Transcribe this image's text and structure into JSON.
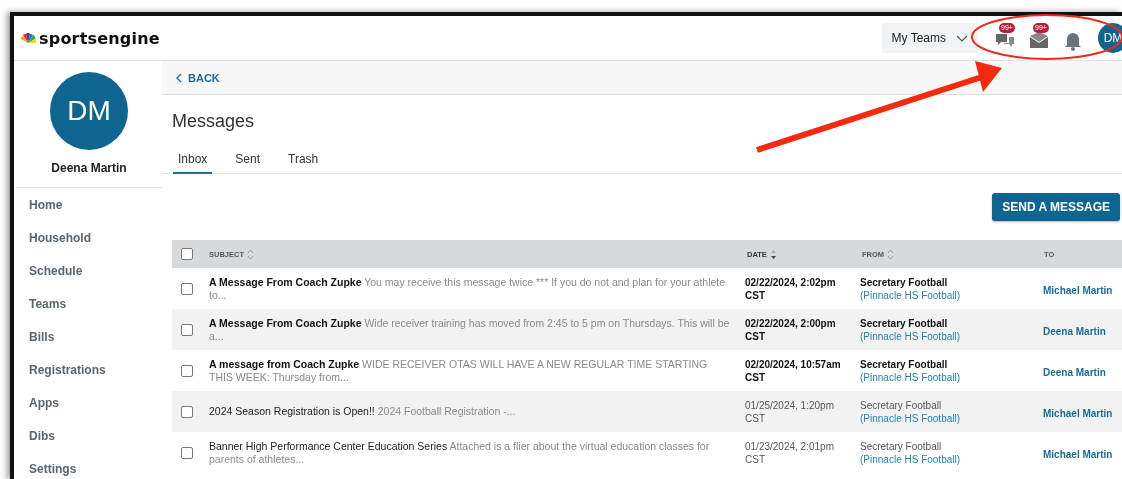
{
  "header": {
    "logo": "sportsengine",
    "team_menu": "My Teams",
    "icons": [
      {
        "kind": "chat",
        "badge": "99+"
      },
      {
        "kind": "mail",
        "badge": "99+"
      },
      {
        "kind": "bell"
      }
    ],
    "avatar": "DM"
  },
  "profile": {
    "initials": "DM",
    "name": "Deena Martin"
  },
  "nav": [
    {
      "label": "Home"
    },
    {
      "label": "Household"
    },
    {
      "label": "Schedule"
    },
    {
      "label": "Teams"
    },
    {
      "label": "Bills"
    },
    {
      "label": "Registrations"
    },
    {
      "label": "Apps"
    },
    {
      "label": "Dibs"
    },
    {
      "label": "Settings"
    }
  ],
  "back": "BACK",
  "title": "Messages",
  "tabs": [
    {
      "label": "Inbox",
      "selected": true
    },
    {
      "label": "Sent",
      "selected": false
    },
    {
      "label": "Trash",
      "selected": false
    }
  ],
  "send_button": "SEND A MESSAGE",
  "table": {
    "select_all": {
      "checked": false
    },
    "columns": [
      {
        "label": "SUBJECT",
        "sortable": true,
        "sorted": false
      },
      {
        "label": "DATE",
        "sortable": true,
        "sorted": true
      },
      {
        "label": "FROM",
        "sortable": true,
        "sorted": false
      },
      {
        "label": "TO",
        "sortable": false,
        "sorted": false
      }
    ],
    "rows": [
      {
        "checked": false,
        "unread": true,
        "subject": "A Message From Coach Zupke",
        "preview": "You may receive this message twice *** If you do not and plan for your athlete to...",
        "date": "02/22/2024, 2:02pm",
        "timezone": "CST",
        "sender": "Secretary Football",
        "team": "(Pinnacle HS Football)",
        "to": "Michael Martin"
      },
      {
        "checked": false,
        "unread": true,
        "subject": "A Message From Coach Zupke",
        "preview": "Wide receiver training has moved from 2:45 to 5 pm on Thursdays.  This will be a...",
        "date": "02/22/2024, 2:00pm",
        "timezone": "CST",
        "sender": "Secretary Football",
        "team": "(Pinnacle HS Football)",
        "to": "Deena Martin"
      },
      {
        "checked": false,
        "unread": true,
        "subject": "A message from Coach Zupke",
        "preview": "WIDE RECEIVER OTAS WILL HAVE A NEW REGULAR TIME STARTING THIS WEEK: Thursday from...",
        "date": "02/20/2024, 10:57am",
        "timezone": "CST",
        "sender": "Secretary Football",
        "team": "(Pinnacle HS Football)",
        "to": "Deena Martin"
      },
      {
        "checked": false,
        "unread": false,
        "subject": "2024 Season Registration is Open!!",
        "preview": "2024 Football Registration -...",
        "date": "01/25/2024, 1:20pm",
        "timezone": "CST",
        "sender": "Secretary Football",
        "team": "(Pinnacle HS Football)",
        "to": "Michael Martin"
      },
      {
        "checked": false,
        "unread": false,
        "subject": "Banner High Performance Center Education Series",
        "preview": "Attached is a flier about the virtual education classes for parents of athletes...",
        "date": "01/23/2024, 2:01pm",
        "timezone": "CST",
        "sender": "Secretary Football",
        "team": "(Pinnacle HS Football)",
        "to": "Michael Martin"
      }
    ]
  }
}
